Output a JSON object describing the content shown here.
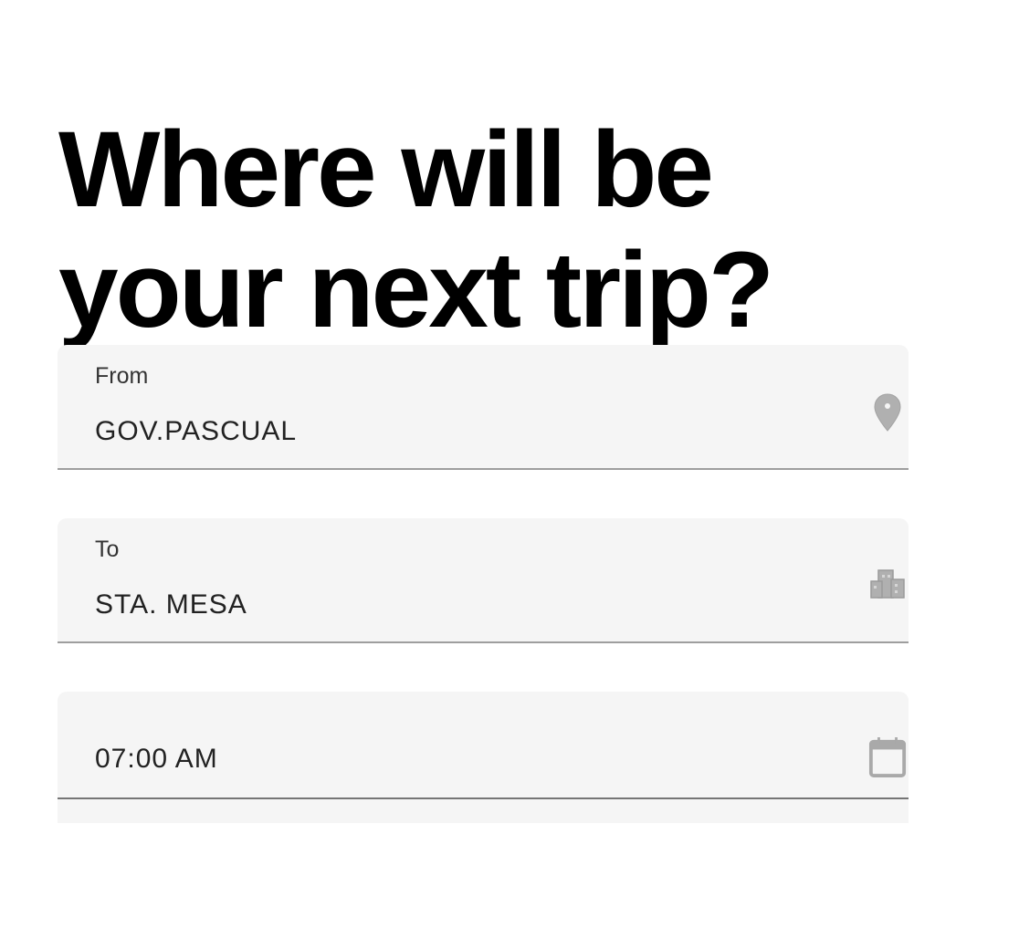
{
  "headline": {
    "line1": "Where will be",
    "line2": "your next trip?"
  },
  "form": {
    "from": {
      "label": "From",
      "value": "GOV.PASCUAL",
      "icon": "location-pin-icon"
    },
    "to": {
      "label": "To",
      "value": "STA. MESA",
      "icon": "city-buildings-icon"
    },
    "time": {
      "value": "07:00 AM",
      "icon": "calendar-icon"
    }
  },
  "colors": {
    "field_background": "#f5f5f5",
    "field_underline": "#9e9e9e",
    "icon_gray": "#b0b0b0",
    "headline": "#000000"
  }
}
